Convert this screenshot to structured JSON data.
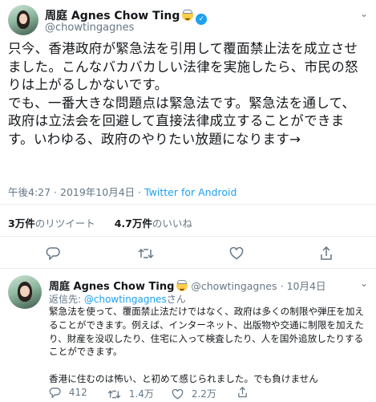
{
  "tweet": {
    "author_name": "周庭 Agnes Chow Ting",
    "author_handle": "@chowtingagnes",
    "text": "只今、香港政府が緊急法を引用して覆面禁止法を成立させました。こんなバカバカしい法律を実施したら、市民の怒りは上がるしかないです。\nでも、一番大きな問題点は緊急法です。緊急法を通して、政府は立法会を回避して直接法律成立することができます。いわゆる、政府のやりたい放題になります→",
    "timestamp": "午後4:27 · 2019年10月4日 ·",
    "source": "Twitter for Android",
    "retweets_count": "3万件",
    "retweets_label": "のリツイート",
    "likes_count": "4.7万件",
    "likes_label": "のいいね"
  },
  "reply": {
    "author_name": "周庭 Agnes Chow Ting",
    "author_handle": "@chowtingagnes",
    "date": "· 10月4日",
    "reply_prefix": "返信先: ",
    "reply_target": "@chowtingagnes",
    "reply_suffix": "さん",
    "paragraph1": "緊急法を使って、覆面禁止法だけではなく、政府は多くの制限や弾圧を加えることができます。例えば、インターネット、出版物や交通に制限を加えたり、財産を没収したり、住宅に入って検査したり、人を国外追放したりすることができます。",
    "paragraph2": "香港に住むのは怖い、と初めて感じられました。でも負けません",
    "reply_count": "412",
    "retweet_count": "1.4万",
    "like_count": "2.2万"
  },
  "icons": {
    "verified": "verified-badge-icon",
    "emoji": "smiling-face-with-halo-emoji",
    "chevron": "chevron-down-icon",
    "reply": "reply-icon",
    "retweet": "retweet-icon",
    "like": "heart-icon",
    "share": "share-icon"
  },
  "colors": {
    "accent": "#1da1f2",
    "muted": "#657786",
    "text": "#14171a",
    "divider": "#e6ecf0"
  }
}
